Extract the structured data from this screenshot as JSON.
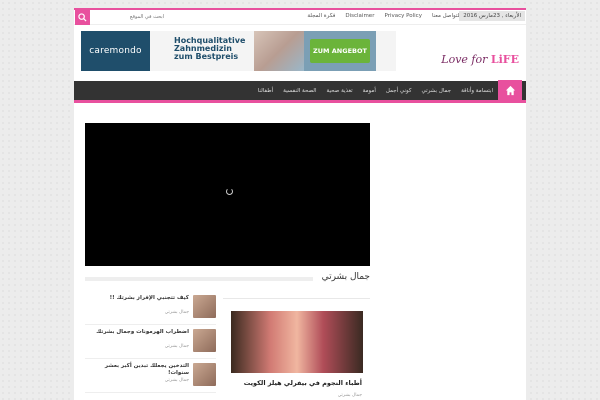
{
  "topbar": {
    "search_placeholder": "ابحث في الموقع",
    "links": [
      "للتواصل معنا",
      "Privacy Policy",
      "Disclaimer",
      "فكرة المجلة"
    ],
    "date": "الأربعاء , 23مارس 2016"
  },
  "ad": {
    "brand": "caremondo",
    "headline_1": "Hochqualitative",
    "headline_2": "Zahnmedizin",
    "headline_3": "zum Bestpreis",
    "cta": "ZUM ANGEBOT"
  },
  "logo": {
    "part1": "Love for ",
    "part2": "LiFE"
  },
  "nav": {
    "items": [
      "ابتسامة وأناقة",
      "جمال بشرتي",
      "كوني أجمل",
      "أمومة",
      "تغذية صحية",
      "الصحة النفسية",
      "أطفالنا"
    ]
  },
  "section": {
    "title": "جمال بشرتي"
  },
  "side_posts": [
    {
      "title": "كيف تتجنبي الإفراز بشرتك !!",
      "category": "جمال بشرتي"
    },
    {
      "title": "اضطراب الهرمونات وجمال بشرتك",
      "category": "جمال بشرتي"
    },
    {
      "title": "التدخين يجعلك تبدين أكبر بعشر سنوات!",
      "category": "جمال بشرتي"
    }
  ],
  "featured": {
    "title": "أطباء النجوم في بيفرلي هيلز الكويت",
    "category": "جمال بشرتي"
  },
  "colors": {
    "accent": "#e8509e",
    "nav_bg": "#333333"
  }
}
